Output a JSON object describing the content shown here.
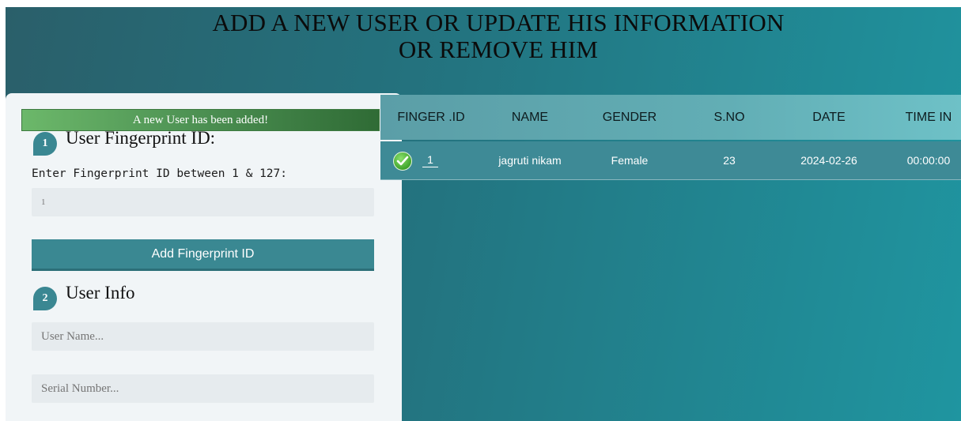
{
  "header": {
    "title_line1": "ADD A NEW USER OR UPDATE HIS INFORMATION",
    "title_line2": "OR REMOVE HIM"
  },
  "alert": {
    "message": "A new User has been added!"
  },
  "form": {
    "step1": {
      "number": "1",
      "title": "User Fingerprint ID:",
      "field_label": "Enter Fingerprint ID between 1 & 127:",
      "fingerprint_value": "1",
      "button_label": "Add Fingerprint ID"
    },
    "step2": {
      "number": "2",
      "title": "User Info",
      "username_placeholder": "User Name...",
      "serial_placeholder": "Serial Number..."
    }
  },
  "table": {
    "columns": [
      "FINGER .ID",
      "NAME",
      "GENDER",
      "S.NO",
      "DATE",
      "TIME IN"
    ],
    "rows": [
      {
        "status_icon": "check-circle-icon",
        "finger_id": "1",
        "name": "jagruti nikam",
        "gender": "Female",
        "serial_no": "23",
        "date": "2024-02-26",
        "time_in": "00:00:00"
      }
    ]
  },
  "colors": {
    "accent": "#3a8892",
    "alert_green": "#4f9455",
    "background_start": "#2a5f6a",
    "background_end": "#1f95a0"
  }
}
